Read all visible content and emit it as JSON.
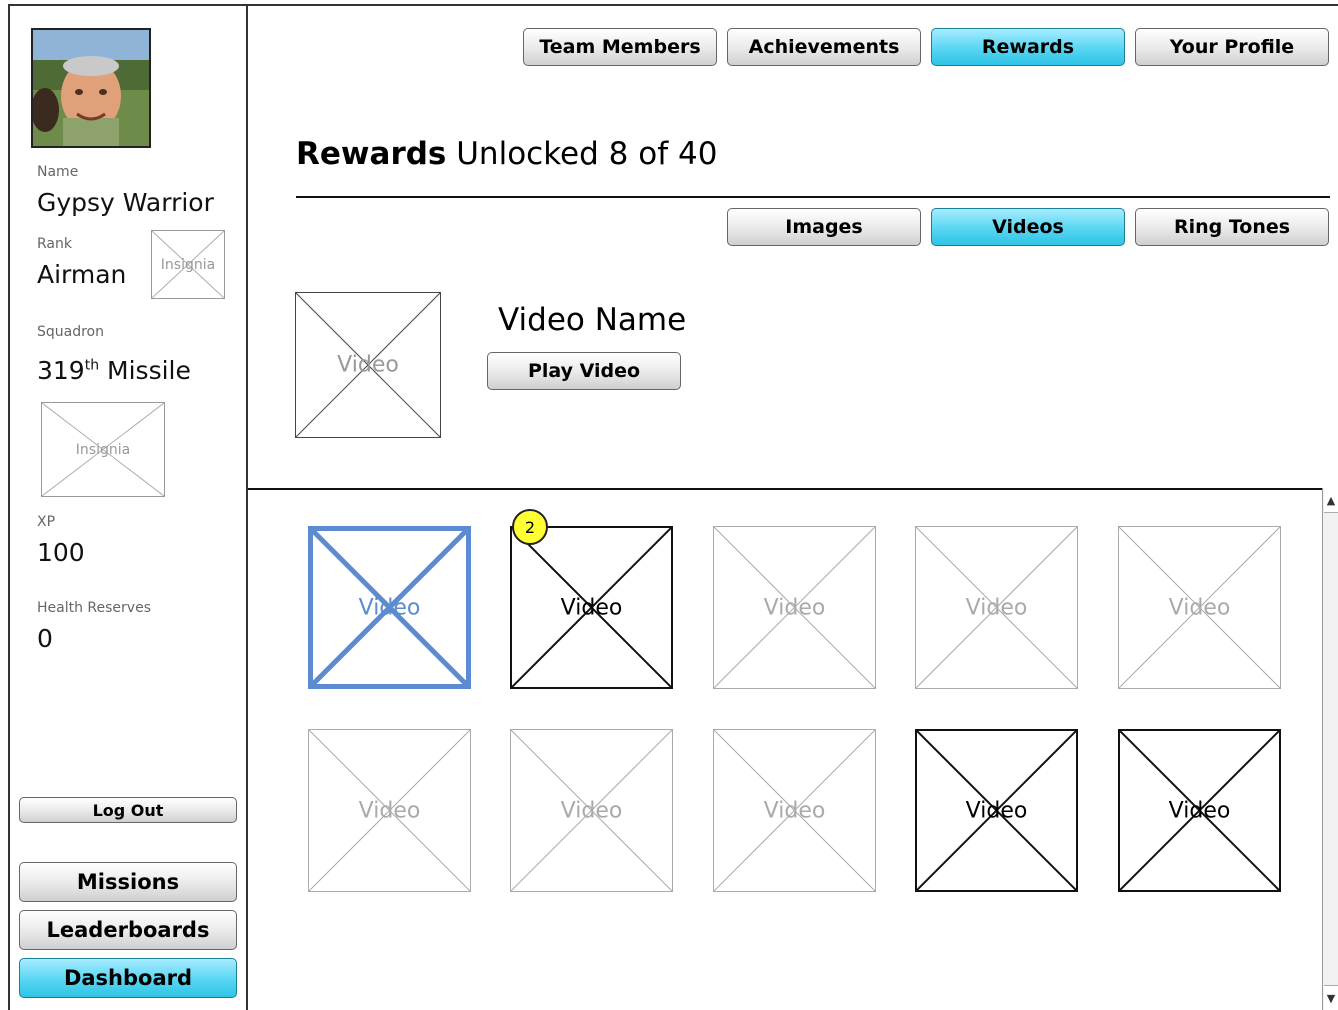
{
  "profile": {
    "name_label": "Name",
    "name": "Gypsy Warrior",
    "rank_label": "Rank",
    "rank": "Airman",
    "rank_insignia": "Insignia",
    "squadron_label": "Squadron",
    "squadron_num": "319",
    "squadron_sup": "th",
    "squadron_name": " Missile",
    "squadron_insignia": "Insignia",
    "xp_label": "XP",
    "xp": "100",
    "health_label": "Health Reserves",
    "health": "0"
  },
  "sidebar": {
    "logout": "Log Out",
    "nav": [
      "Missions",
      "Leaderboards",
      "Dashboard"
    ]
  },
  "top_tabs": [
    "Team Members",
    "Achievements",
    "Rewards",
    "Your Profile"
  ],
  "page": {
    "title_bold": "Rewards",
    "title_rest": " Unlocked 8 of 40"
  },
  "sub_tabs": [
    "Images",
    "Videos",
    "Ring Tones"
  ],
  "feature": {
    "thumb": "Video",
    "name": "Video Name",
    "play": "Play Video"
  },
  "grid": {
    "tile_caption": "Video",
    "badge": "2"
  },
  "colors": {
    "active_tab": "#57d6f2",
    "selected_tile": "#5b8bd0",
    "badge": "#ffff33"
  }
}
